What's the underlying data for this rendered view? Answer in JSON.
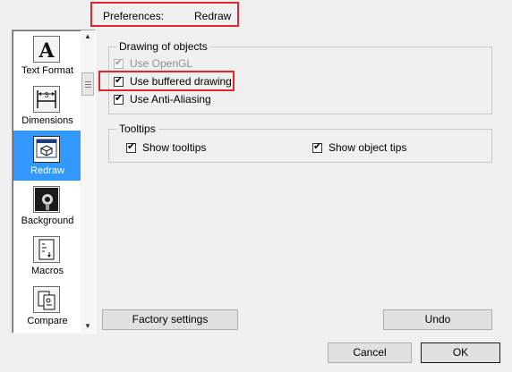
{
  "header": {
    "label": "Preferences:",
    "value": "Redraw"
  },
  "categories": [
    {
      "label": "Text Format",
      "icon": "text-format-icon"
    },
    {
      "label": "Dimensions",
      "icon": "dimensions-icon"
    },
    {
      "label": "Redraw",
      "icon": "redraw-icon",
      "selected": true
    },
    {
      "label": "Background",
      "icon": "background-icon"
    },
    {
      "label": "Macros",
      "icon": "macros-icon"
    },
    {
      "label": "Compare",
      "icon": "compare-icon"
    }
  ],
  "drawing": {
    "title": "Drawing of objects",
    "use_opengl": {
      "label": "Use OpenGL",
      "checked": true,
      "disabled": true
    },
    "use_buffered": {
      "label": "Use buffered drawing",
      "checked": true
    },
    "use_antialias": {
      "label": "Use Anti-Aliasing",
      "checked": true
    }
  },
  "tooltips": {
    "title": "Tooltips",
    "show_tooltips": {
      "label": "Show tooltips",
      "checked": true
    },
    "show_object_tips": {
      "label": "Show object tips",
      "checked": true
    }
  },
  "buttons": {
    "factory": "Factory settings",
    "undo": "Undo",
    "cancel": "Cancel",
    "ok": "OK"
  },
  "colors": {
    "selection": "#3399ff",
    "highlight_frame": "#e0262c"
  }
}
